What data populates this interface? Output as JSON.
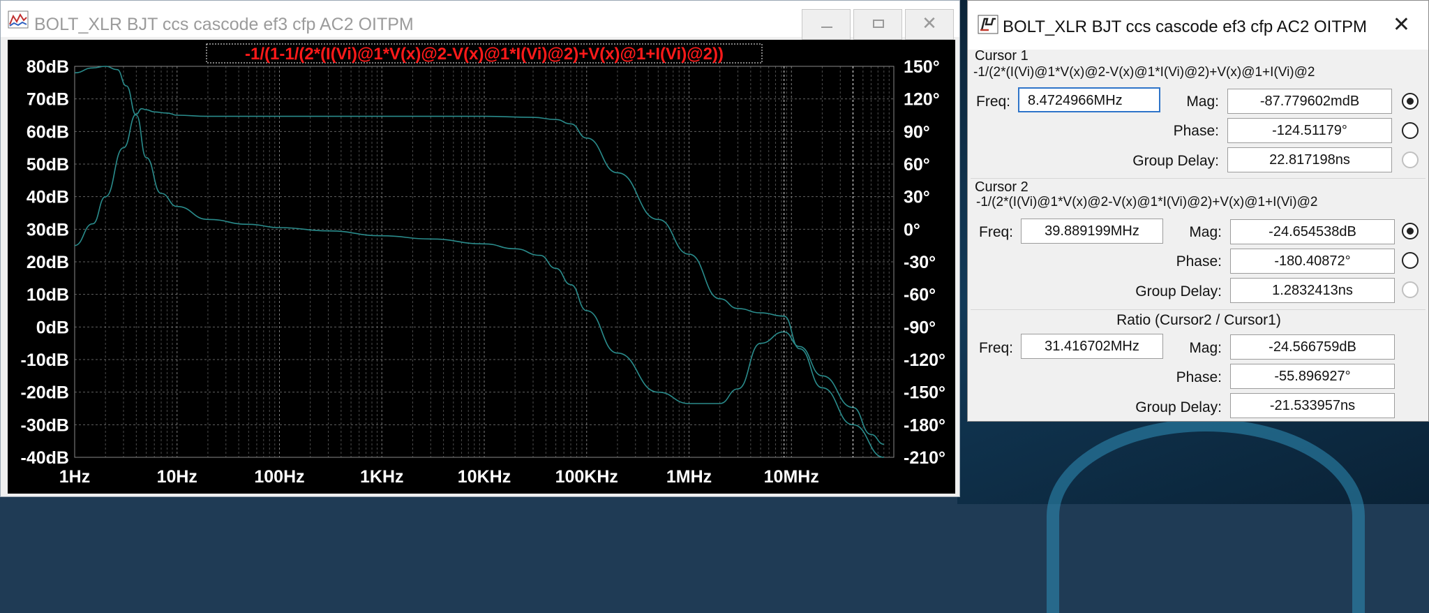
{
  "plot_window": {
    "title": "BOLT_XLR BJT ccs cascode ef3 cfp AC2 OITPM",
    "buttons": {
      "minimize": "minimize-icon",
      "maximize": "maximize-icon",
      "close": "close-icon"
    },
    "trace_label": "-1/(1-1/(2*(I(Vi)@1*V(x)@2-V(x)@1*I(Vi)@2)+V(x)@1+I(Vi)@2))"
  },
  "chart_data": {
    "type": "line",
    "xscale": "log",
    "xlim_hz": [
      1,
      100000000
    ],
    "x_tick_labels": [
      "1Hz",
      "10Hz",
      "100Hz",
      "1KHz",
      "10KHz",
      "100KHz",
      "1MHz",
      "10MHz"
    ],
    "left_axis": {
      "label": "",
      "unit": "dB",
      "ylim": [
        -40,
        80
      ],
      "tick_labels": [
        "80dB",
        "70dB",
        "60dB",
        "50dB",
        "40dB",
        "30dB",
        "20dB",
        "10dB",
        "0dB",
        "-10dB",
        "-20dB",
        "-30dB",
        "-40dB"
      ]
    },
    "right_axis": {
      "label": "",
      "unit": "°",
      "ylim": [
        -210,
        150
      ],
      "tick_labels": [
        "150°",
        "120°",
        "90°",
        "60°",
        "30°",
        "0°",
        "-30°",
        "-60°",
        "-90°",
        "-120°",
        "-150°",
        "-180°",
        "-210°"
      ]
    },
    "grid": true,
    "colors": {
      "background": "#000000",
      "trace": "#2a8c8c",
      "grid": "#8c8c8c",
      "axis_text": "#ffffff",
      "trace_label": "#ff1a1a"
    },
    "cursor_lines_hz": [
      8472496.6,
      39889199
    ],
    "series": [
      {
        "name": "-1/(1-1/(2*(I(Vi)@1*V(x)@2-V(x)@1*I(Vi)@2)+V(x)@1+I(Vi)@2))",
        "quantity": "magnitude",
        "axis": "left",
        "x": [
          1,
          1.5,
          2,
          2.6,
          3.2,
          4,
          5,
          7,
          10,
          20,
          50,
          100,
          300,
          1000,
          3000,
          10000,
          20000,
          35000,
          50000,
          70000,
          100000,
          200000,
          500000,
          1000000,
          2000000,
          3000000,
          5000000,
          8472496.6,
          12000000,
          20000000,
          39889199,
          60000000,
          80000000
        ],
        "y": [
          78,
          79.5,
          80,
          79,
          74,
          65,
          52,
          41,
          37,
          33,
          31.5,
          30.5,
          29.5,
          28,
          27,
          25.5,
          24,
          22,
          18,
          13,
          5,
          -8,
          -20,
          -23.5,
          -23.5,
          -19,
          -5,
          -1.5,
          -6,
          -15,
          -24.7,
          -33,
          -36
        ]
      },
      {
        "name": "-1/(1-1/(2*(I(Vi)@1*V(x)@2-V(x)@1*I(Vi)@2)+V(x)@1+I(Vi)@2))",
        "quantity": "phase",
        "axis": "right",
        "x": [
          1,
          1.5,
          2,
          3,
          4,
          4.5,
          5,
          6,
          8,
          10,
          20,
          100,
          1000,
          10000,
          30000,
          50000,
          70000,
          100000,
          200000,
          500000,
          1000000,
          2000000,
          3000000,
          5000000,
          8472496.6,
          12000000,
          20000000,
          39889199,
          80000000
        ],
        "y": [
          -15,
          5,
          30,
          75,
          106,
          111,
          110,
          108,
          107,
          105,
          104,
          104,
          104,
          104,
          103,
          101,
          97,
          84,
          52,
          9,
          -23,
          -64,
          -73,
          -77,
          -80,
          -110,
          -146,
          -180,
          -210
        ]
      }
    ]
  },
  "cursor_window": {
    "title": "BOLT_XLR BJT ccs cascode ef3 cfp AC2 OITPM",
    "cursor1": {
      "title": "Cursor 1",
      "expr": "-1/(2*(I(Vi)@1*V(x)@2-V(x)@1*I(Vi)@2)+V(x)@1+I(Vi)@2",
      "freq_label": "Freq:",
      "freq": "8.4724966MHz",
      "mag_label": "Mag:",
      "mag": "-87.779602mdB",
      "phase_label": "Phase:",
      "phase": "-124.51179°",
      "gd_label": "Group Delay:",
      "gd": "22.817198ns"
    },
    "cursor2": {
      "title": "Cursor 2",
      "expr": "-1/(2*(I(Vi)@1*V(x)@2-V(x)@1*I(Vi)@2)+V(x)@1+I(Vi)@2",
      "freq_label": "Freq:",
      "freq": "39.889199MHz",
      "mag_label": "Mag:",
      "mag": "-24.654538dB",
      "phase_label": "Phase:",
      "phase": "-180.40872°",
      "gd_label": "Group Delay:",
      "gd": "1.2832413ns"
    },
    "ratio": {
      "title": "Ratio (Cursor2 / Cursor1)",
      "freq_label": "Freq:",
      "freq": "31.416702MHz",
      "mag_label": "Mag:",
      "mag": "-24.566759dB",
      "phase_label": "Phase:",
      "phase": "-55.896927°",
      "gd_label": "Group Delay:",
      "gd": "-21.533957ns"
    }
  }
}
